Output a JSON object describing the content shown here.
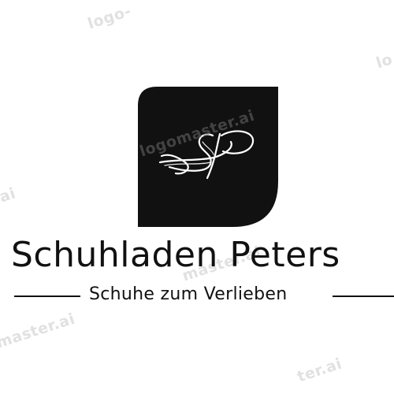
{
  "brand": {
    "monogram": "SP",
    "name": "Schuhladen Peters",
    "tagline": "Schuhe zum Verlieben"
  },
  "watermark": {
    "text_short": "logo-",
    "text_mid": "logomaster.ai",
    "text_master": "master.ai",
    "text_ter": "ter.ai",
    "text_ai": "ai",
    "text_lo": "lo"
  },
  "colors": {
    "background": "#ffffff",
    "mark": "#111111",
    "text": "#111111",
    "watermark": "#c9c9c9"
  }
}
